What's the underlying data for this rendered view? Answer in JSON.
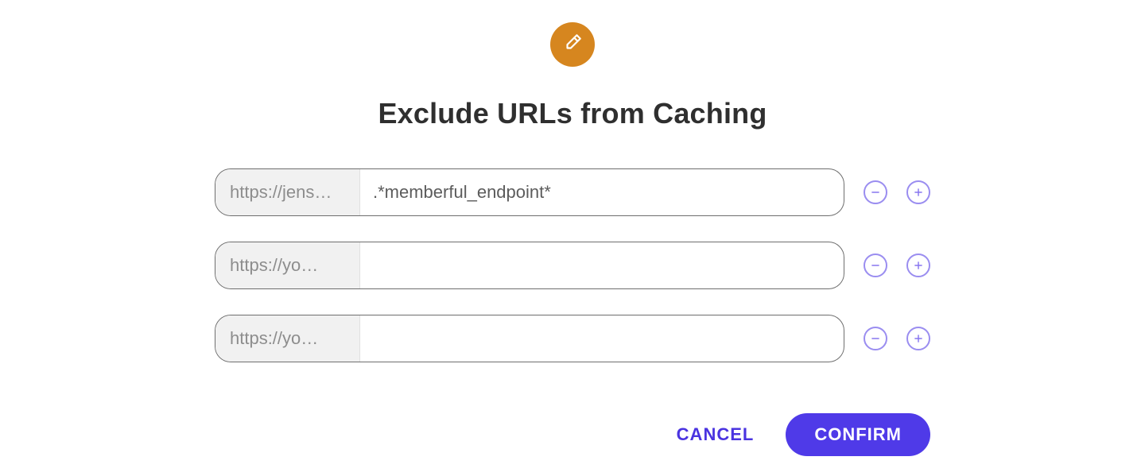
{
  "colors": {
    "accent": "#4f3ae8",
    "badge": "#d6861f",
    "icon_outline": "#9a8df0"
  },
  "header": {
    "icon": "pencil-icon",
    "title": "Exclude URLs from Caching"
  },
  "rows": [
    {
      "prefix": "https://jens…",
      "value": ".*memberful_endpoint*",
      "placeholder": ""
    },
    {
      "prefix": "https://yo…",
      "value": "",
      "placeholder": ""
    },
    {
      "prefix": "https://yo…",
      "value": "",
      "placeholder": ""
    }
  ],
  "row_actions": {
    "remove_label": "Remove URL",
    "add_label": "Add URL"
  },
  "actions": {
    "cancel_label": "CANCEL",
    "confirm_label": "CONFIRM"
  }
}
